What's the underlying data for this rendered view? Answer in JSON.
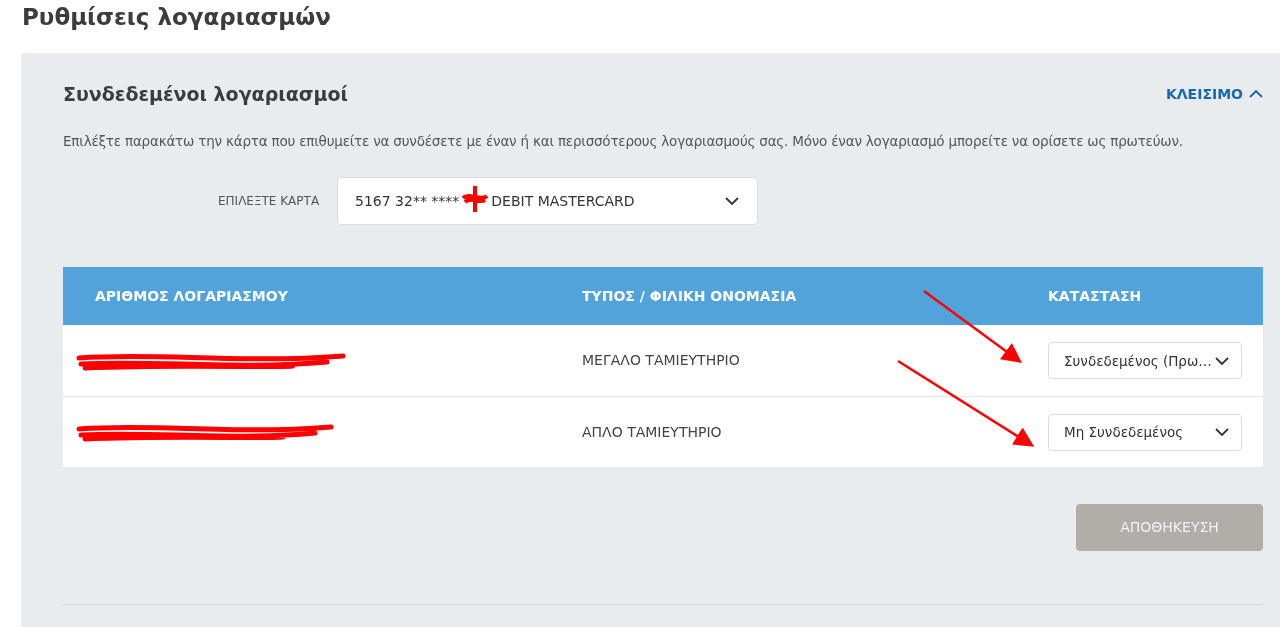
{
  "page_title": "Ρυθμίσεις λογαριασμών",
  "section": {
    "title": "Συνδεδεμένοι λογαριασμοί",
    "toggle": {
      "label": "ΚΛΕΙΣΙΜΟ",
      "expanded": true
    },
    "description": "Επιλέξτε παρακάτω την κάρτα που επιθυμείτε να συνδέσετε με έναν ή και περισσότερους λογαριασμούς σας. Μόνο έναν λογαριασμό μπορείτε να ορίσετε ως πρωτεύων.",
    "card_select": {
      "label": "ΕΠΙΛΕΞΤΕ ΚΑΡΤΑ",
      "value_start": "5167 32** ****",
      "value_end": "DEBIT MASTERCARD"
    },
    "table": {
      "columns": [
        "ΑΡΙΘΜΟΣ ΛΟΓΑΡΙΑΣΜΟΥ",
        "ΤΥΠΟΣ / ΦΙΛΙΚΗ ΟΝΟΜΑΣΙΑ",
        "ΚΑΤΑΣΤΑΣΗ"
      ],
      "rows": [
        {
          "type": "ΜΕΓΑΛΟ ΤΑΜΙΕΥΤΗΡΙΟ",
          "status": "Συνδεδεμένος (Πρω…"
        },
        {
          "type": "ΑΠΛΟ ΤΑΜΙΕΥΤΗΡΙΟ",
          "status": "Μη Συνδεδεμένος"
        }
      ]
    },
    "save_button": {
      "label": "ΑΠΟΘΗΚΕΥΣΗ",
      "disabled": true
    }
  }
}
